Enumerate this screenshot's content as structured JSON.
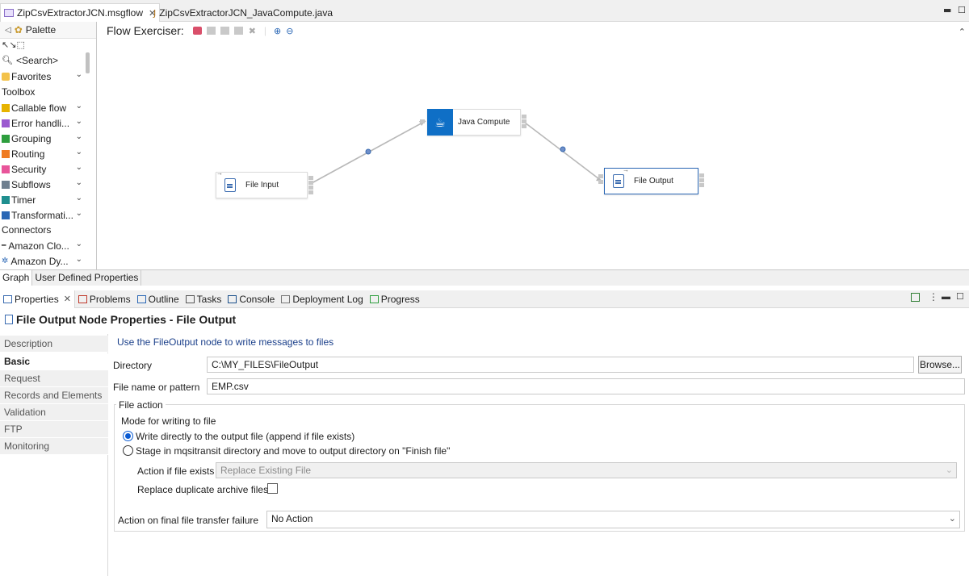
{
  "editor_tabs": [
    {
      "label": "ZipCsvExtractorJCN.msgflow",
      "active": true
    },
    {
      "label": "ZipCsvExtractorJCN_JavaCompute.java",
      "active": false
    }
  ],
  "palette": {
    "title": "Palette",
    "search": "<Search>",
    "favorites": "Favorites",
    "toolbox_title": "Toolbox",
    "toolbox_items": [
      "Callable flow",
      "Error handli...",
      "Grouping",
      "Routing",
      "Security",
      "Subflows",
      "Timer",
      "Transformati..."
    ],
    "toolbox_colors": [
      "#e7b300",
      "#9b59d0",
      "#2e9e3e",
      "#ef7b22",
      "#e8559a",
      "#6f7f8f",
      "#1f8f8f",
      "#2a67b5"
    ],
    "connectors_title": "Connectors",
    "connector_items": [
      "Amazon Clo...",
      "Amazon Dy..."
    ]
  },
  "canvas": {
    "toolbar_label": "Flow Exerciser:",
    "nodes": {
      "file_input": "File Input",
      "java_compute": "Java Compute",
      "file_output": "File Output"
    }
  },
  "graph_tabs": [
    "Graph",
    "User Defined Properties"
  ],
  "views_tabs": [
    "Properties",
    "Problems",
    "Outline",
    "Tasks",
    "Console",
    "Deployment Log",
    "Progress"
  ],
  "properties": {
    "title": "File Output Node Properties - File Output",
    "nav": [
      "Description",
      "Basic",
      "Request",
      "Records and Elements",
      "Validation",
      "FTP",
      "Monitoring"
    ],
    "active_nav": "Basic",
    "hint": "Use the FileOutput node to write messages to files",
    "directory_label": "Directory",
    "directory_value": "C:\\MY_FILES\\FileOutput",
    "browse_label": "Browse...",
    "filename_label": "File name or pattern",
    "filename_value": "EMP.csv",
    "file_action_group": "File action",
    "mode_label": "Mode for writing to file",
    "mode_option_1": "Write directly to the output file (append if file exists)",
    "mode_option_2": "Stage in mqsitransit directory and move to output directory on \"Finish file\"",
    "action_if_exists_label": "Action if file exists",
    "action_if_exists_value": "Replace Existing File",
    "replace_duplicate_label": "Replace duplicate archive files",
    "final_failure_label": "Action on final file transfer failure",
    "final_failure_value": "No Action"
  }
}
